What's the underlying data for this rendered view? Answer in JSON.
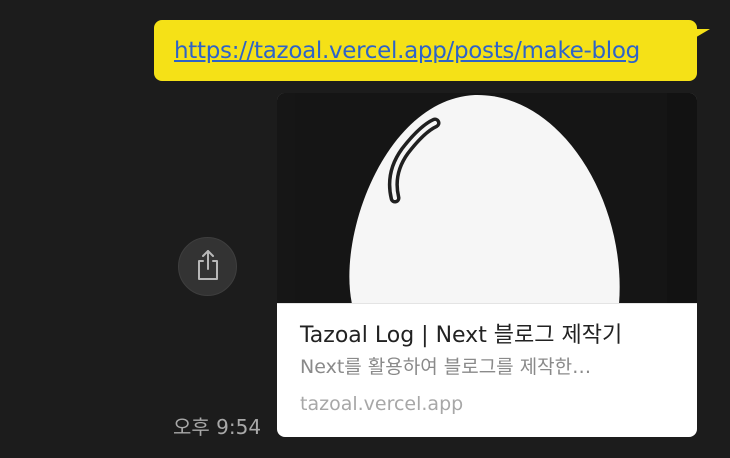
{
  "message": {
    "link_text": "https://tazoal.vercel.app/posts/make-blog",
    "timestamp": "오후 9:54"
  },
  "preview": {
    "image": "egg-illustration",
    "title": "Tazoal Log | Next 블로그 제작기",
    "description": "Next를 활용하여 블로그를 제작한…",
    "domain": "tazoal.vercel.app"
  },
  "share_button": {
    "icon": "share-icon"
  },
  "colors": {
    "background": "#1c1c1c",
    "bubble": "#f5e117",
    "link": "#2e63c8",
    "card": "#ffffff"
  }
}
